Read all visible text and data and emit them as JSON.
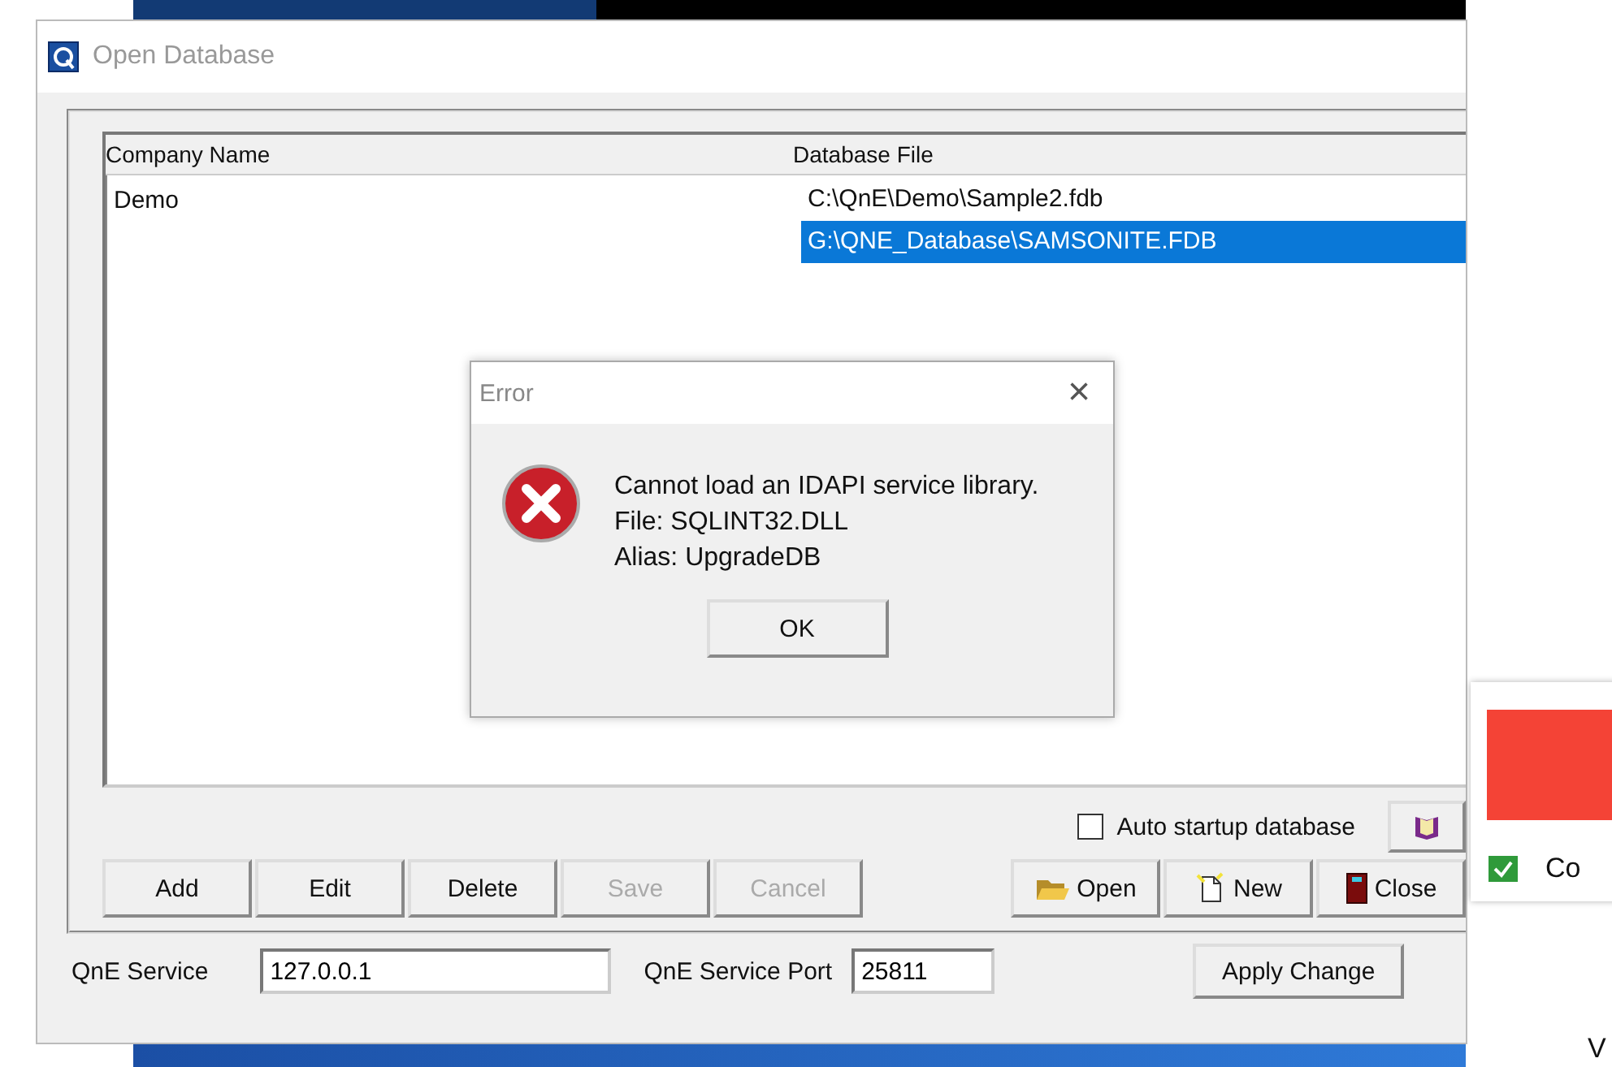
{
  "window": {
    "title": "Open Database"
  },
  "table": {
    "columns": [
      "Company Name",
      "Database File"
    ],
    "rows": [
      {
        "company": "Demo",
        "file": "C:\\QnE\\Demo\\Sample2.fdb",
        "selected": false
      },
      {
        "file": "G:\\QNE_Database\\SAMSONITE.FDB",
        "selected": true
      }
    ]
  },
  "auto_startup": {
    "label": "Auto startup database",
    "checked": false
  },
  "edit_buttons": [
    {
      "label": "Add",
      "disabled": false
    },
    {
      "label": "Edit",
      "disabled": false
    },
    {
      "label": "Delete",
      "disabled": false
    },
    {
      "label": "Save",
      "disabled": true
    },
    {
      "label": "Cancel",
      "disabled": true
    }
  ],
  "action_buttons": [
    {
      "label": "Open",
      "kind": "open"
    },
    {
      "label": "New",
      "kind": "new"
    },
    {
      "label": "Close",
      "kind": "close"
    }
  ],
  "service": {
    "label": "QnE Service",
    "value": "127.0.0.1",
    "port_label": "QnE Service Port",
    "port_value": "25811",
    "apply": "Apply Change"
  },
  "error_dialog": {
    "title": "Error",
    "close": "×",
    "lines": [
      "Cannot load an IDAPI service library.",
      "File: SQLINT32.DLL",
      "Alias: UpgradeDB"
    ],
    "ok": "OK"
  },
  "notification": {
    "text": "Co"
  },
  "stray_text": "V"
}
